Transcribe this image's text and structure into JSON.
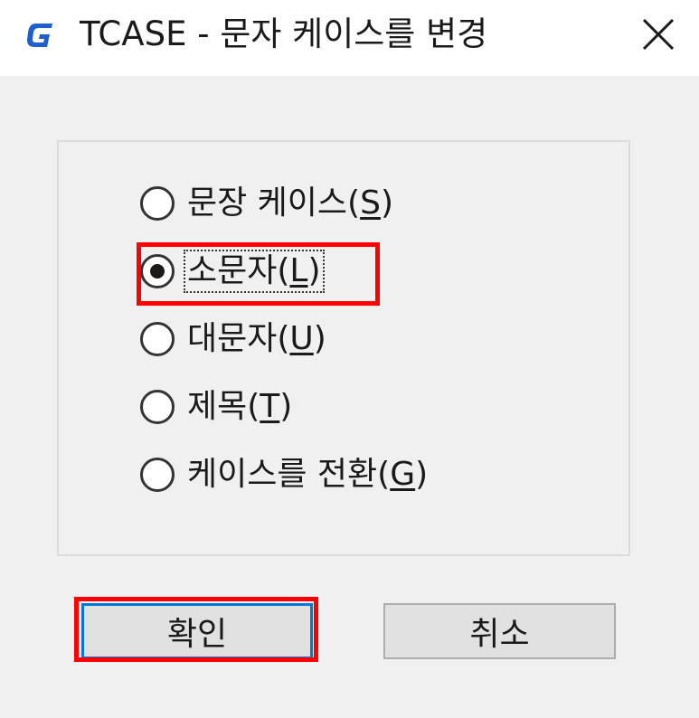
{
  "window": {
    "title": "TCASE - 문자 케이스를 변경",
    "icon": "gstarcad-g-icon",
    "close_glyph": "✕"
  },
  "options": [
    {
      "text": "문장 케이스(",
      "key": "S",
      "suffix": ")",
      "selected": false
    },
    {
      "text": "소문자(",
      "key": "L",
      "suffix": ")",
      "selected": true
    },
    {
      "text": "대문자(",
      "key": "U",
      "suffix": ")",
      "selected": false
    },
    {
      "text": "제목(",
      "key": "T",
      "suffix": ")",
      "selected": false
    },
    {
      "text": "케이스를 전환(",
      "key": "G",
      "suffix": ")",
      "selected": false
    }
  ],
  "buttons": {
    "ok_label": "확인",
    "cancel_label": "취소"
  },
  "colors": {
    "highlight": "#ff0000",
    "accent": "#0078d7",
    "icon_blue": "#1e5fcf"
  }
}
